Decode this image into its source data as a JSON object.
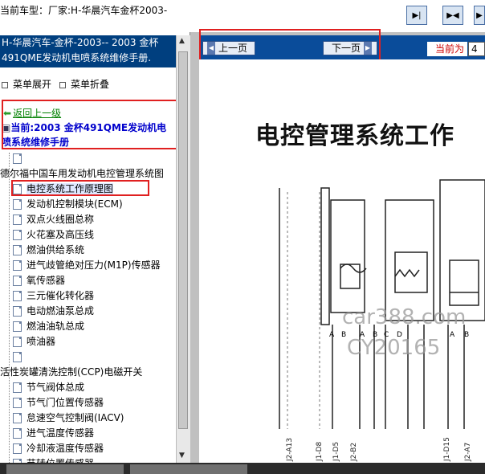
{
  "topbar": {
    "car_label": "当前车型：厂家:H-华晨汽车金杯2003-",
    "buttons": [
      "first-page-icon",
      "fit-width-icon",
      "fit-page-icon"
    ]
  },
  "sidebar": {
    "title": "H-华晨汽车-金杯-2003-- 2003 金杯491QME发动机电喷系统维修手册.",
    "expand_label": "菜单展开",
    "collapse_label": "菜单折叠",
    "back_label": "返回上一级",
    "current_label": "当前:2003 金杯491QME发动机电喷系统维修手册",
    "tree": [
      {
        "label": "",
        "depth": 1
      },
      {
        "label": "德尔福中国车用发动机电控管理系统图",
        "depth": 0
      },
      {
        "label": "电控系统工作原理图",
        "depth": 1,
        "selected": true
      },
      {
        "label": "发动机控制模块(ECM)",
        "depth": 1
      },
      {
        "label": "双点火线圈总称",
        "depth": 1
      },
      {
        "label": "火花塞及高压线",
        "depth": 1
      },
      {
        "label": "燃油供给系统",
        "depth": 1
      },
      {
        "label": "进气歧管绝对压力(M1P)传感器",
        "depth": 1
      },
      {
        "label": "氧传感器",
        "depth": 1
      },
      {
        "label": "三元催化转化器",
        "depth": 1
      },
      {
        "label": "电动燃油泵总成",
        "depth": 1
      },
      {
        "label": "燃油油轨总成",
        "depth": 1
      },
      {
        "label": "喷油器",
        "depth": 1
      },
      {
        "label": "",
        "depth": 1
      },
      {
        "label": "活性炭罐清洗控制(CCP)电磁开关",
        "depth": 0
      },
      {
        "label": "节气阀体总成",
        "depth": 1
      },
      {
        "label": "节气门位置传感器",
        "depth": 1
      },
      {
        "label": "怠速空气控制阀(IACV)",
        "depth": 1
      },
      {
        "label": "进气温度传感器",
        "depth": 1
      },
      {
        "label": "冷却液温度传感器",
        "depth": 1
      },
      {
        "label": "节转位置传感器",
        "depth": 1
      }
    ]
  },
  "viewer": {
    "prev_label": "上一页",
    "next_label": "下一页",
    "current_page_label": "当前为",
    "current_page_value": "4",
    "diagram_title": "电控管理系统工作",
    "watermark1": "car388.com",
    "watermark2": "CY20165",
    "pins": [
      "J2-A13",
      "J1-D8",
      "J1-D5",
      "J2-B2",
      "J1-D15",
      "J2-A7"
    ],
    "letters": [
      "A",
      "B",
      "A",
      "B",
      "C",
      "D",
      "A",
      "B"
    ]
  },
  "colors": {
    "accent_red": "#e02020",
    "header_blue": "#003f7f",
    "link_green": "#008000",
    "current_blue": "#0000cc"
  }
}
